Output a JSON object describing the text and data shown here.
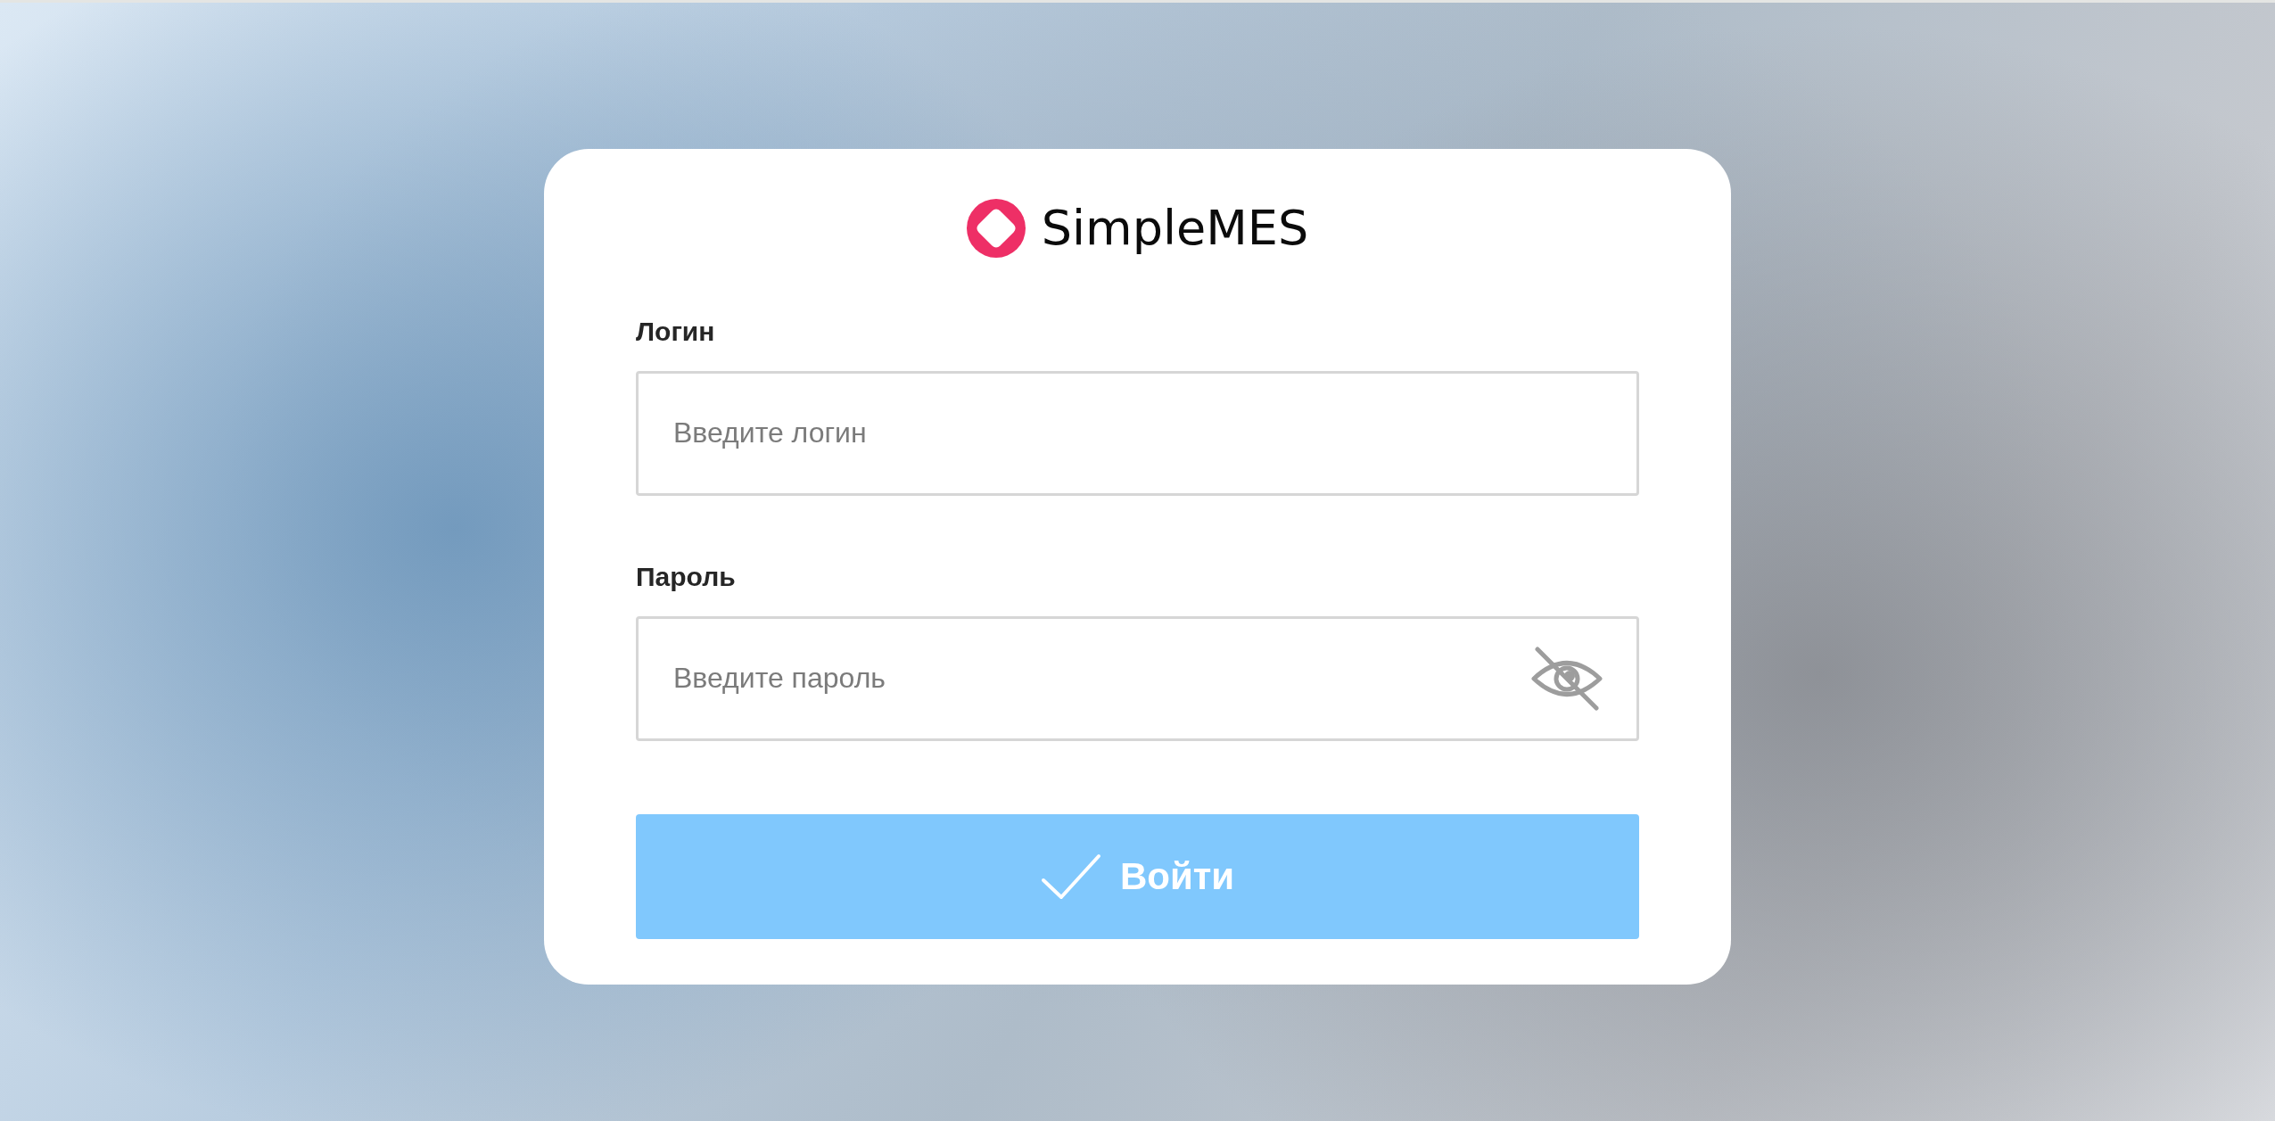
{
  "logo": {
    "text": "SimpleMES"
  },
  "fields": [
    {
      "kind": "text",
      "label": "Логин",
      "placeholder": "Введите логин"
    },
    {
      "kind": "password",
      "label": "Пароль",
      "placeholder": "Введите пароль",
      "password_hidden": true
    }
  ],
  "submit_button": {
    "label": "Войти",
    "disabled": true
  }
}
